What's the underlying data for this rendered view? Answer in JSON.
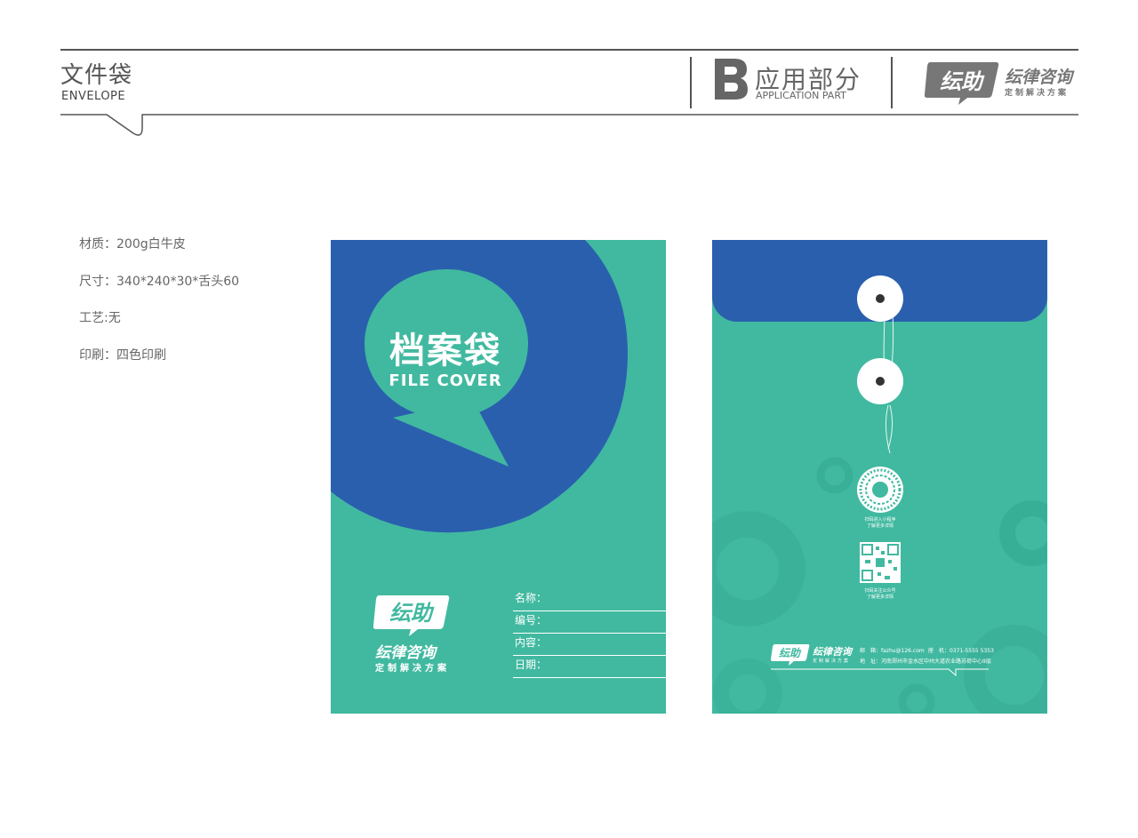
{
  "header": {
    "title": "文件袋",
    "subtitle": "ENVELOPE",
    "section_letter": "B",
    "section_title": "应用部分",
    "section_sub": "APPLICATION PART",
    "brand_badge": "纭助",
    "brand_name": "纭律咨询",
    "brand_slogan": "定制解决方案"
  },
  "specs": [
    {
      "label": "材质：200g白牛皮"
    },
    {
      "label": "尺寸：340*240*30*舌头60"
    },
    {
      "label": "工艺:无"
    },
    {
      "label": "印刷：四色印刷"
    }
  ],
  "front": {
    "title": "档案袋",
    "title_en": "FILE COVER",
    "brand_badge": "纭助",
    "brand_name": "纭律咨询",
    "brand_slogan": "定制解决方案",
    "fields": [
      "名称：",
      "编号：",
      "内容：",
      "日期："
    ]
  },
  "back": {
    "qr1_caption_1": "扫码进入小程序",
    "qr1_caption_2": "了解更多详情",
    "qr2_caption_1": "扫码关注公众号",
    "qr2_caption_2": "了解更多详情",
    "brand_badge": "纭助",
    "brand_name": "纭律咨询",
    "brand_slogan": "定制解决方案",
    "email": "邮　箱：fazhu@126.com",
    "phone": "座　机：0371-5555 5353",
    "address": "地　址：河南郑州市金水区中州大道农业路苏荷中心9层"
  },
  "colors": {
    "teal": "#41b9a0",
    "blue": "#2a5fae",
    "text_gray": "#555555"
  }
}
